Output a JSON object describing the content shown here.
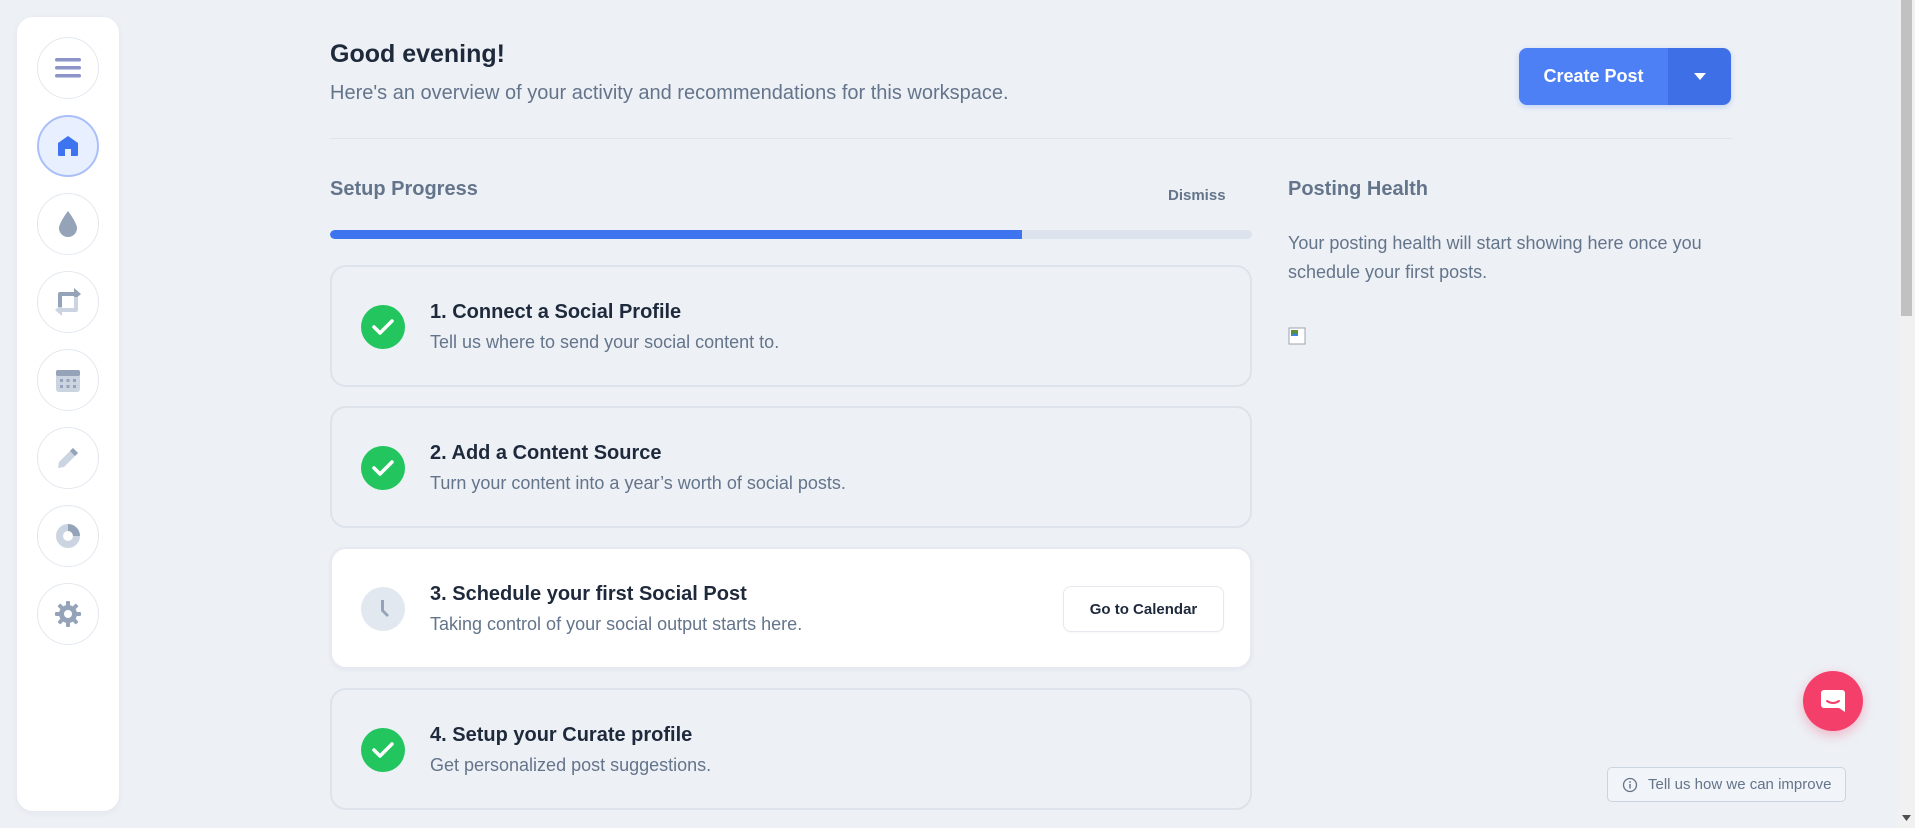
{
  "sidebar": {
    "items": [
      {
        "name": "menu",
        "icon": "menu-icon",
        "active": false
      },
      {
        "name": "home",
        "icon": "home-icon",
        "active": true
      },
      {
        "name": "content-sources",
        "icon": "droplet-icon",
        "active": false
      },
      {
        "name": "recycle",
        "icon": "repeat-icon",
        "active": false
      },
      {
        "name": "calendar",
        "icon": "calendar-icon",
        "active": false
      },
      {
        "name": "compose",
        "icon": "pencil-icon",
        "active": false
      },
      {
        "name": "analytics",
        "icon": "pie-chart-icon",
        "active": false
      },
      {
        "name": "settings",
        "icon": "gear-icon",
        "active": false
      }
    ]
  },
  "header": {
    "greeting": "Good evening!",
    "subtitle": "Here's an overview of your activity and recommendations for this workspace.",
    "create_post_label": "Create Post",
    "create_post_menu_icon": "caret-down-icon"
  },
  "setup": {
    "title": "Setup Progress",
    "dismiss_label": "Dismiss",
    "progress_fraction": 0.75,
    "steps": [
      {
        "title": "1. Connect a Social Profile",
        "description": "Tell us where to send your social content to.",
        "status": "done"
      },
      {
        "title": "2. Add a Content Source",
        "description": "Turn your content into a year’s worth of social posts.",
        "status": "done"
      },
      {
        "title": "3. Schedule your first Social Post",
        "description": "Taking control of your social output starts here.",
        "status": "pending",
        "action_label": "Go to Calendar"
      },
      {
        "title": "4. Setup your Curate profile",
        "description": "Get personalized post suggestions.",
        "status": "done"
      }
    ]
  },
  "health": {
    "title": "Posting Health",
    "text": "Your posting health will start showing here once you schedule your first posts."
  },
  "feedback": {
    "label": "Tell us how we can improve",
    "icon": "info-icon"
  },
  "chat": {
    "icon": "chat-icon"
  },
  "colors": {
    "accent": "#4d7ff5",
    "success": "#22c55e",
    "chat": "#f43f6b",
    "background": "#edf1f6"
  }
}
